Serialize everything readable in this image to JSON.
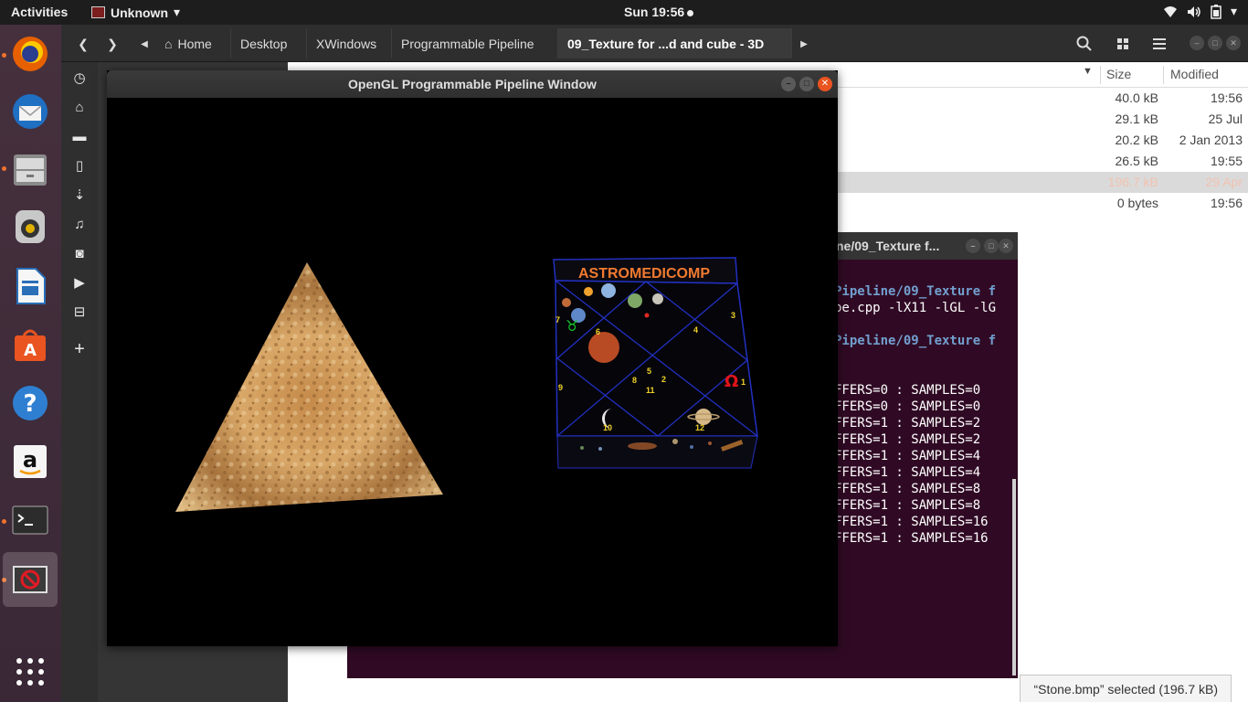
{
  "topbar": {
    "activities": "Activities",
    "app_name": "Unknown",
    "clock": "Sun 19:56"
  },
  "file_manager": {
    "breadcrumbs": [
      "Home",
      "Desktop",
      "XWindows",
      "Programmable Pipeline",
      "09_Texture for ...d and cube - 3D"
    ],
    "columns": {
      "size": "Size",
      "modified": "Modified"
    },
    "rows": [
      {
        "size": "40.0 kB",
        "modified": "19:56"
      },
      {
        "size": "29.1 kB",
        "modified": "25 Jul"
      },
      {
        "size": "20.2 kB",
        "modified": "2 Jan 2013"
      },
      {
        "size": "26.5 kB",
        "modified": "19:55"
      },
      {
        "size": "196.7 kB",
        "modified": "29 Apr"
      },
      {
        "size": "0 bytes",
        "modified": "19:56"
      }
    ],
    "status": "“Stone.bmp” selected  (196.7 kB)"
  },
  "terminal": {
    "title": "ne/09_Texture f...",
    "lines": [
      {
        "text": "Pipeline/09_Texture f",
        "style": "blue"
      },
      {
        "text": "be.cpp -lX11 -lGL -lG",
        "style": "plain"
      },
      {
        "text": "",
        "style": "plain"
      },
      {
        "text": "Pipeline/09_Texture f",
        "style": "blue"
      },
      {
        "text": "",
        "style": "plain"
      },
      {
        "text": "",
        "style": "plain"
      },
      {
        "text": "FFERS=0 : SAMPLES=0",
        "style": "plain"
      },
      {
        "text": "FFERS=0 : SAMPLES=0",
        "style": "plain"
      },
      {
        "text": "FFERS=1 : SAMPLES=2",
        "style": "plain"
      },
      {
        "text": "FFERS=1 : SAMPLES=2",
        "style": "plain"
      },
      {
        "text": "FFERS=1 : SAMPLES=4",
        "style": "plain"
      },
      {
        "text": "FFERS=1 : SAMPLES=4",
        "style": "plain"
      },
      {
        "text": "FFERS=1 : SAMPLES=8",
        "style": "plain"
      },
      {
        "text": "FFERS=1 : SAMPLES=8",
        "style": "plain"
      },
      {
        "text": "FFERS=1 : SAMPLES=16",
        "style": "plain"
      },
      {
        "text": "FFERS=1 : SAMPLES=16",
        "style": "plain"
      }
    ]
  },
  "gl_window": {
    "title": "OpenGL Programmable Pipeline Window",
    "cube_label": "ASTROMEDICOMP",
    "house_numbers": [
      "1",
      "2",
      "3",
      "4",
      "5",
      "6",
      "7",
      "8",
      "9",
      "10",
      "11",
      "12"
    ]
  },
  "dock": {
    "apps": [
      "firefox-icon",
      "thunderbird-icon",
      "files-icon",
      "rhythmbox-icon",
      "writer-icon",
      "software-icon",
      "help-icon",
      "amazon-icon",
      "terminal-icon",
      "opengl-app-icon",
      "show-apps-icon"
    ]
  },
  "colors": {
    "topbar": "#1d1d1d",
    "dock": "#3b2b3b",
    "terminal_bg": "#300a24",
    "accent": "#e95420"
  }
}
